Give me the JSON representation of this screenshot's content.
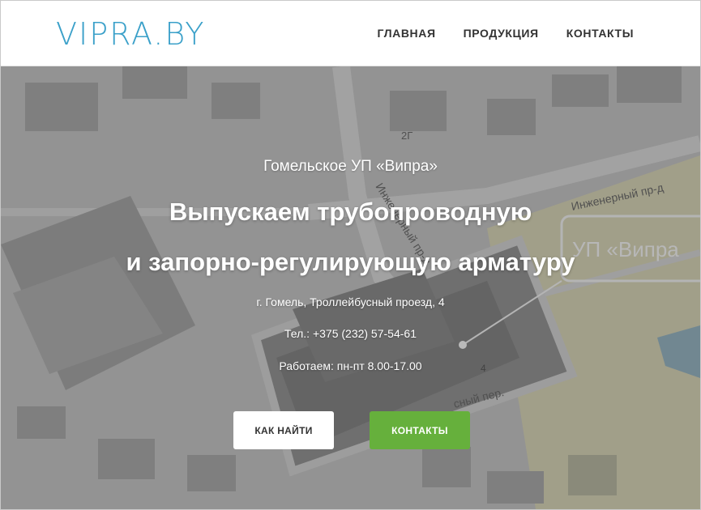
{
  "header": {
    "logo": "VIPRA.BY",
    "nav": [
      {
        "label": "ГЛАВНАЯ"
      },
      {
        "label": "ПРОДУКЦИЯ"
      },
      {
        "label": "КОНТАКТЫ"
      }
    ]
  },
  "hero": {
    "subtitle": "Гомельское УП «Випра»",
    "headline_line1": "Выпускаем трубопроводную",
    "headline_line2": "и запорно-регулирующую арматуру",
    "address": "г. Гомель, Троллейбусный проезд, 4",
    "phone": "Тел.: +375 (232) 57-54-61",
    "hours": "Работаем: пн-пт 8.00-17.00",
    "buttons": {
      "find": "КАК НАЙТИ",
      "contacts": "КОНТАКТЫ"
    }
  },
  "map": {
    "street1": "Инженерный пр-д",
    "street2": "Инженерный пр-д",
    "street3": "сный пер.",
    "marker_label": "УП «Випра",
    "building_number_1": "2Г",
    "building_number_2": "4"
  },
  "colors": {
    "logo": "#3aa0c9",
    "button_green": "#66b03c",
    "nav_text": "#333333"
  }
}
